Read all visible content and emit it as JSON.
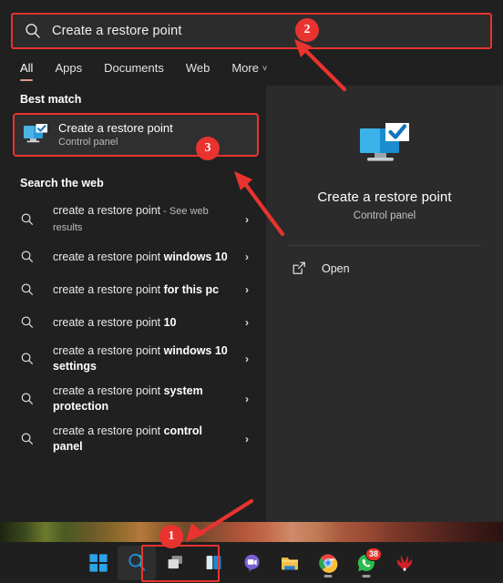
{
  "search": {
    "value": "Create a restore point",
    "icon": "search-icon"
  },
  "tabs": [
    {
      "label": "All",
      "active": true
    },
    {
      "label": "Apps",
      "active": false
    },
    {
      "label": "Documents",
      "active": false
    },
    {
      "label": "Web",
      "active": false
    },
    {
      "label": "More",
      "active": false,
      "chevron": "˅"
    }
  ],
  "sections": {
    "best_match_header": "Best match",
    "search_web_header": "Search the web"
  },
  "best_match": {
    "title": "Create a restore point",
    "subtitle": "Control panel",
    "icon": "restore-point-icon"
  },
  "web_results": [
    {
      "prefix": "create a restore point",
      "suffix": "",
      "tail": " - See web results",
      "chevron": "›"
    },
    {
      "prefix": "create a restore point ",
      "suffix": "windows 10",
      "tail": "",
      "chevron": "›"
    },
    {
      "prefix": "create a restore point ",
      "suffix": "for this pc",
      "tail": "",
      "chevron": "›"
    },
    {
      "prefix": "create a restore point ",
      "suffix": "10",
      "tail": "",
      "chevron": "›"
    },
    {
      "prefix": "create a restore point ",
      "suffix": "windows 10 settings",
      "tail": "",
      "chevron": "›"
    },
    {
      "prefix": "create a restore point ",
      "suffix": "system protection",
      "tail": "",
      "chevron": "›"
    },
    {
      "prefix": "create a restore point ",
      "suffix": "control panel",
      "tail": "",
      "chevron": "›"
    }
  ],
  "preview": {
    "title": "Create a restore point",
    "subtitle": "Control panel",
    "icon": "restore-point-large-icon",
    "action_label": "Open",
    "action_icon": "open-external-icon"
  },
  "taskbar": {
    "items": [
      {
        "name": "start",
        "label": "Start",
        "badge": null,
        "running": false,
        "active": false
      },
      {
        "name": "search",
        "label": "Search",
        "badge": null,
        "running": false,
        "active": true
      },
      {
        "name": "task-view",
        "label": "Task View",
        "badge": null,
        "running": false,
        "active": false
      },
      {
        "name": "widgets",
        "label": "Widgets",
        "badge": null,
        "running": false,
        "active": false
      },
      {
        "name": "teams-chat",
        "label": "Chat",
        "badge": null,
        "running": false,
        "active": false
      },
      {
        "name": "file-explorer",
        "label": "File Explorer",
        "badge": null,
        "running": false,
        "active": false
      },
      {
        "name": "google-chrome",
        "label": "Google Chrome",
        "badge": null,
        "running": true,
        "active": false
      },
      {
        "name": "whatsapp",
        "label": "WhatsApp",
        "badge": "38",
        "running": true,
        "active": false
      },
      {
        "name": "huawei-pc-manager",
        "label": "Huawei PC Manager",
        "badge": null,
        "running": false,
        "active": false
      }
    ]
  },
  "annotations": {
    "step1": "1",
    "step2": "2",
    "step3": "3",
    "accent_color": "#e8332f"
  }
}
